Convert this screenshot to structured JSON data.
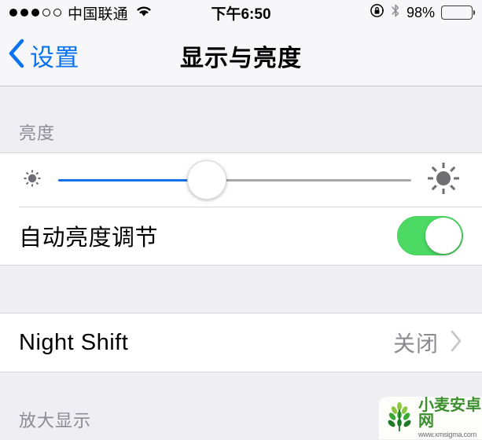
{
  "status_bar": {
    "signal": {
      "filled": 3,
      "empty": 2,
      "icon": "signal-dots"
    },
    "carrier": "中国联通",
    "wifi_icon": "wifi-icon",
    "time": "下午6:50",
    "rotation_lock_icon": "rotation-lock-icon",
    "bluetooth_icon": "bluetooth-icon",
    "battery_percent": "98%",
    "battery_level": 98,
    "battery_color": "#ffcc00"
  },
  "nav_bar": {
    "back_label": "设置",
    "back_chevron_icon": "chevron-left-icon",
    "title": "显示与亮度",
    "tint_color": "#0a73ef"
  },
  "brightness_section": {
    "header": "亮度",
    "slider": {
      "value": 42,
      "min_icon": "brightness-low-icon",
      "max_icon": "brightness-high-icon",
      "fill_color": "#1471e8"
    },
    "auto_brightness": {
      "label": "自动亮度调节",
      "toggle_state": "on",
      "toggle_color": "#4cd964"
    }
  },
  "night_shift_section": {
    "label": "Night Shift",
    "value": "关闭",
    "disclosure_icon": "chevron-right-icon"
  },
  "display_zoom_section": {
    "header": "放大显示"
  },
  "watermark": {
    "logo_icon": "wheat-logo-icon",
    "name": "小麦安卓网",
    "url": "www.xmsigma.com"
  }
}
